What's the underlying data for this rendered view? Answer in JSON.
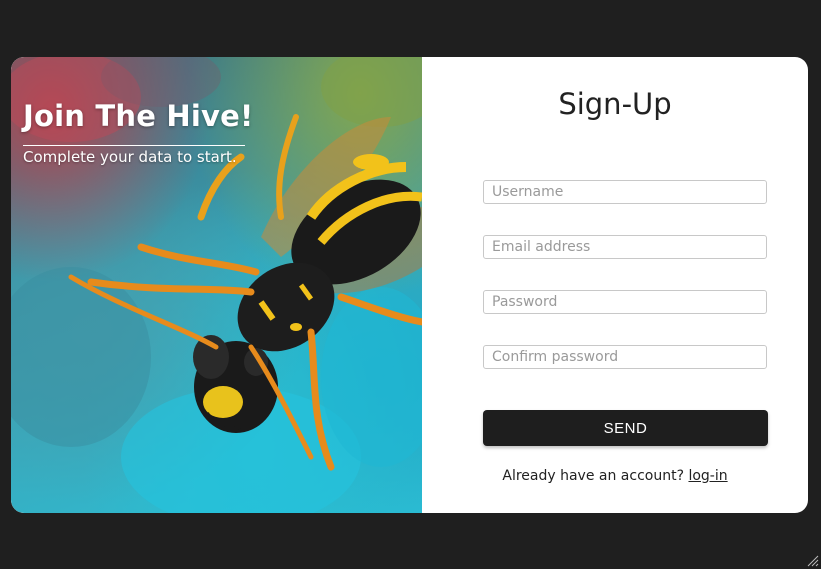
{
  "hero": {
    "title": "Join The Hive!",
    "subtitle": "Complete your data to start."
  },
  "form": {
    "title": "Sign-Up",
    "fields": [
      {
        "placeholder": "Username",
        "value": ""
      },
      {
        "placeholder": "Email address",
        "value": ""
      },
      {
        "placeholder": "Password",
        "value": ""
      },
      {
        "placeholder": "Confirm password",
        "value": ""
      }
    ],
    "send_label": "SEND",
    "login_prompt": "Already have an account?",
    "login_link": "log-in"
  },
  "colors": {
    "page_background": "#1f1f1f",
    "card_background": "#ffffff",
    "button_background": "#1e1e1e",
    "button_text": "#ffffff"
  }
}
